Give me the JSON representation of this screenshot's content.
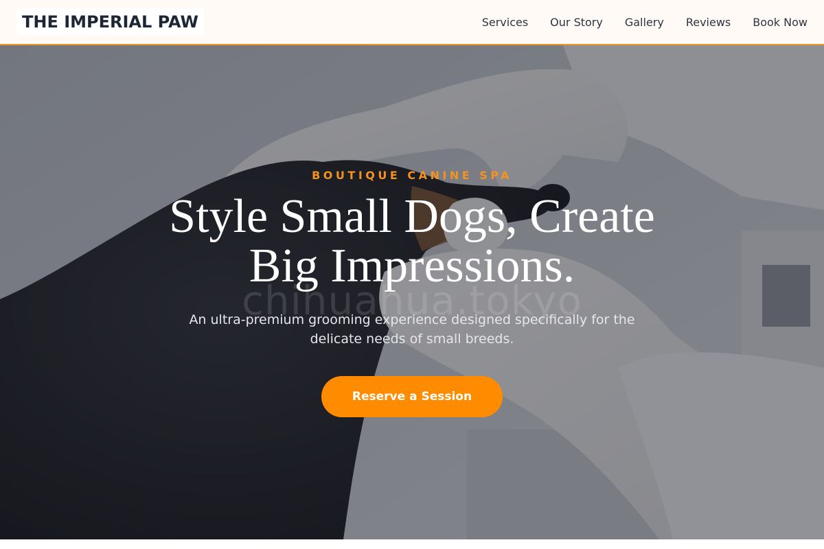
{
  "header": {
    "logo": "THE IMPERIAL PAW",
    "nav": [
      {
        "label": "Services"
      },
      {
        "label": "Our Story"
      },
      {
        "label": "Gallery"
      },
      {
        "label": "Reviews"
      },
      {
        "label": "Book Now"
      }
    ]
  },
  "hero": {
    "eyebrow": "BOUTIQUE CANINE SPA",
    "headline": "Style Small Dogs, Create Big Impressions.",
    "subtext": "An ultra-premium grooming experience designed specifically for the delicate needs of small breeds.",
    "cta_label": "Reserve a Session",
    "watermark": "chihuahua.tokyo"
  },
  "colors": {
    "accent": "#ff8c00",
    "header_bg": "#fffaf5",
    "logo_text": "#1c2635"
  }
}
